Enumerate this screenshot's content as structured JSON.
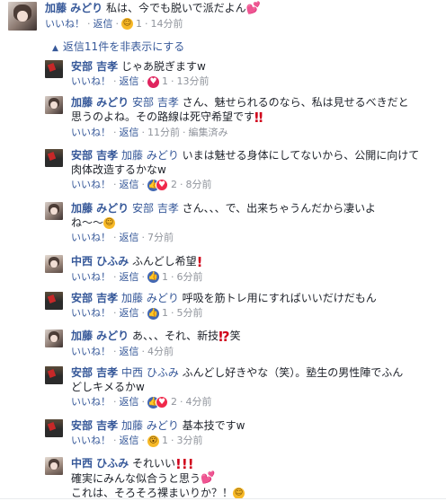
{
  "comments": {
    "c0": {
      "name": "加藤 みどり",
      "text": "私は、今でも脱いで派だよん",
      "emoji_after": "heart",
      "like": "いいね！",
      "reply": "返信",
      "reaction": "haha",
      "count": "1",
      "time": "14分前"
    },
    "collapse_label": "返信11件を非表示にする",
    "c1": {
      "name": "安部 吉孝",
      "text": "じゃあ脱ぎますw",
      "like": "いいね！",
      "reply": "返信",
      "reaction": "love",
      "count": "1",
      "time": "13分前"
    },
    "c2": {
      "name": "加藤 みどり",
      "tag": "安部 吉孝",
      "text1": " さん、魅せられるのなら、私は見せるべきだと",
      "text2": "思うのよね。その路線は死守希望です",
      "emoji_after": "excl",
      "like": "いいね！",
      "reply": "返信",
      "time": "11分前",
      "edited": "編集済み"
    },
    "c3": {
      "name": "安部 吉孝",
      "tag": "加藤 みどり",
      "text1": " いまは魅せる身体にしてないから、公開に向けて",
      "text2": "肉体改造するかなw",
      "like": "いいね！",
      "reply": "返信",
      "count": "2",
      "time": "8分前"
    },
    "c4": {
      "name": "加藤 みどり",
      "tag": "安部 吉孝",
      "text1": " さん、、、で、出来ちゃうんだから凄いよ",
      "text2": "ね〜〜",
      "emoji_after": "smile",
      "like": "いいね！",
      "reply": "返信",
      "time": "7分前"
    },
    "c5": {
      "name": "中西 ひふみ",
      "text": "ふんどし希望",
      "emoji_after": "excl",
      "like": "いいね！",
      "reply": "返信",
      "reaction": "like",
      "count": "1",
      "time": "6分前"
    },
    "c6": {
      "name": "安部 吉孝",
      "tag": "加藤 みどり",
      "text": " 呼吸を筋トレ用にすればいいだけだもん",
      "like": "いいね！",
      "reply": "返信",
      "reaction": "like",
      "count": "1",
      "time": "5分前"
    },
    "c7": {
      "name": "加藤 みどり",
      "text": "あ、、、それ、新技",
      "emoji_after": "⁉",
      "text_tail": "笑",
      "like": "いいね！",
      "reply": "返信",
      "time": "4分前"
    },
    "c8": {
      "name": "安部 吉孝",
      "tag": "中西 ひふみ",
      "text1": " ふんどし好きやな（笑）。塾生の男性陣でふん",
      "text2": "どしキメるかw",
      "like": "いいね！",
      "reply": "返信",
      "count": "2",
      "time": "4分前"
    },
    "c9": {
      "name": "安部 吉孝",
      "tag": "加藤 みどり",
      "text": " 基本技ですw",
      "like": "いいね！",
      "reply": "返信",
      "reaction": "wow",
      "count": "1",
      "time": "3分前"
    },
    "c10": {
      "name": "中西 ひふみ",
      "text1": "それいい",
      "text2": "確実にみんな似合うと思う",
      "text3": "これは、そろそろ裸まいりか？！"
    }
  },
  "icons": [
    "haha-reaction-icon",
    "love-reaction-icon",
    "like-reaction-icon",
    "wow-reaction-icon",
    "chevron-up-icon",
    "avatar"
  ],
  "colors": {
    "name": "#365899",
    "meta": "#90949c",
    "text": "#1d2129",
    "like": "#4267b2",
    "love": "#e0245e"
  }
}
